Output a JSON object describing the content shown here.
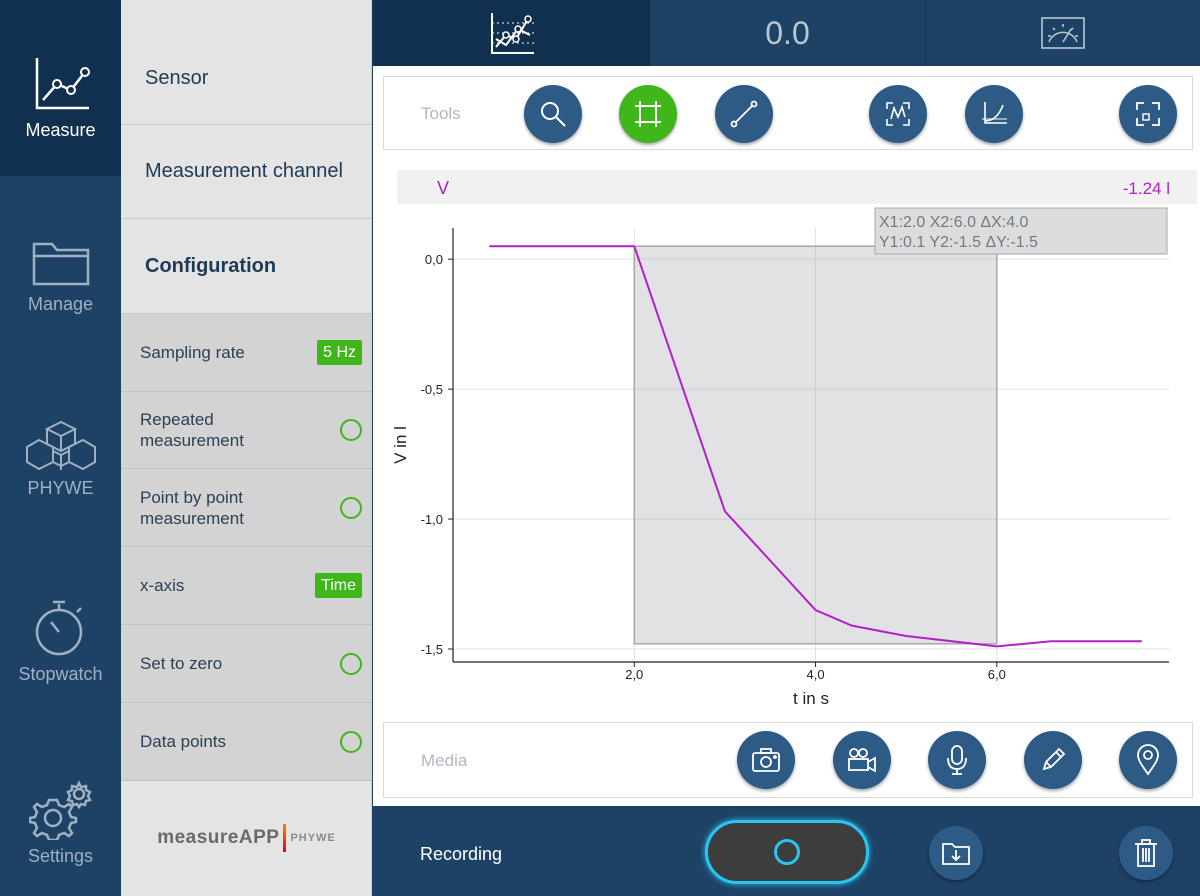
{
  "nav": {
    "items": [
      {
        "label": "Measure"
      },
      {
        "label": "Manage"
      },
      {
        "label": "PHYWE"
      },
      {
        "label": "Stopwatch"
      },
      {
        "label": "Settings"
      }
    ]
  },
  "panel": {
    "sensor": "Sensor",
    "channel": "Measurement channel",
    "configuration": "Configuration",
    "rows": [
      {
        "label": "Sampling rate",
        "badge": "5 Hz"
      },
      {
        "label": "Repeated\nmeasurement"
      },
      {
        "label": "Point by point\nmeasurement"
      },
      {
        "label": "x-axis",
        "badge": "Time"
      },
      {
        "label": "Set to zero"
      },
      {
        "label": "Data points"
      }
    ],
    "logo_main": "measureAPP",
    "logo_brand": "PHYWE"
  },
  "tabs": {
    "display_value": "0.0"
  },
  "tools": {
    "title": "Tools"
  },
  "media": {
    "title": "Media"
  },
  "recording": {
    "label": "Recording"
  },
  "colors": {
    "series": "#b41fc9",
    "accent_green": "#3fb61a",
    "record_ring": "#27c6f2",
    "nav_bg": "#1e4266"
  },
  "chart_data": {
    "type": "line",
    "series_label": "V",
    "current_value": "-1.24 l",
    "xlabel": "t in s",
    "ylabel": "V in l",
    "xlim": [
      0.0,
      7.9
    ],
    "ylim": [
      -1.55,
      0.12
    ],
    "x_ticks": [
      "2,0",
      "4,0",
      "6,0"
    ],
    "x_tick_values": [
      2.0,
      4.0,
      6.0
    ],
    "y_ticks": [
      "0,0",
      "-0,5",
      "-1,0",
      "-1,5"
    ],
    "y_tick_values": [
      0.0,
      -0.5,
      -1.0,
      -1.5
    ],
    "series": [
      {
        "name": "V",
        "x": [
          0.4,
          2.0,
          3.0,
          4.0,
          4.4,
          5.0,
          6.0,
          6.6,
          7.6
        ],
        "y": [
          0.05,
          0.05,
          -0.97,
          -1.35,
          -1.41,
          -1.45,
          -1.49,
          -1.47,
          -1.47
        ]
      }
    ],
    "selection": {
      "x1": 2.0,
      "x2": 6.0,
      "y1": 0.05,
      "y2": -1.48
    },
    "cursor_readout": {
      "line1": "X1:2.0  X2:6.0  ΔX:4.0",
      "line2": "Y1:0.1  Y2:-1.5  ΔY:-1.5"
    },
    "grid": true
  }
}
